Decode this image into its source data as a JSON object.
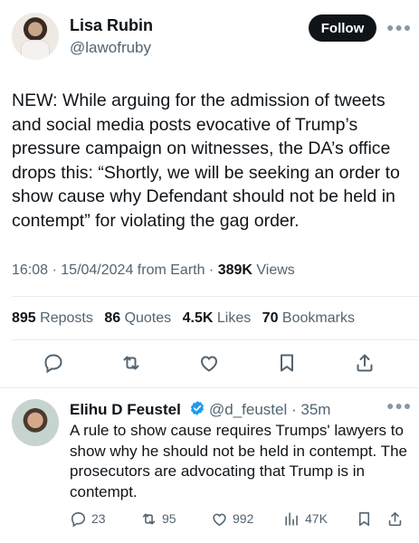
{
  "author": {
    "name": "Lisa Rubin",
    "handle": "@lawofruby",
    "follow_label": "Follow"
  },
  "tweet": {
    "text": "NEW: While arguing for the admission of tweets and social media posts evocative of Trump’s pressure campaign on witnesses, the DA’s office drops this: “Shortly, we will be seeking an order to show cause why Defendant should not be held in contempt” for violating the gag order.",
    "time": "16:08",
    "date": "15/04/2024",
    "source": "from Earth",
    "views_count": "389K",
    "views_label": "Views"
  },
  "stats": {
    "reposts_count": "895",
    "reposts_label": "Reposts",
    "quotes_count": "86",
    "quotes_label": "Quotes",
    "likes_count": "4.5K",
    "likes_label": "Likes",
    "bookmarks_count": "70",
    "bookmarks_label": "Bookmarks"
  },
  "actions": [
    "reply-icon",
    "repost-icon",
    "like-icon",
    "bookmark-icon",
    "share-icon"
  ],
  "reply": {
    "name": "Elihu D Feustel",
    "handle": "@d_feustel",
    "time": "35m",
    "text": "A rule to show cause requires Trumps' lawyers to show why he should not be held in contempt. The prosecutors are advocating that Trump is in contempt.",
    "replies": "23",
    "reposts": "95",
    "likes": "992",
    "views": "47K"
  },
  "colors": {
    "text": "#0f1419",
    "secondary": "#536471",
    "accent": "#1d9bf0",
    "divider": "#e6ecf0"
  }
}
